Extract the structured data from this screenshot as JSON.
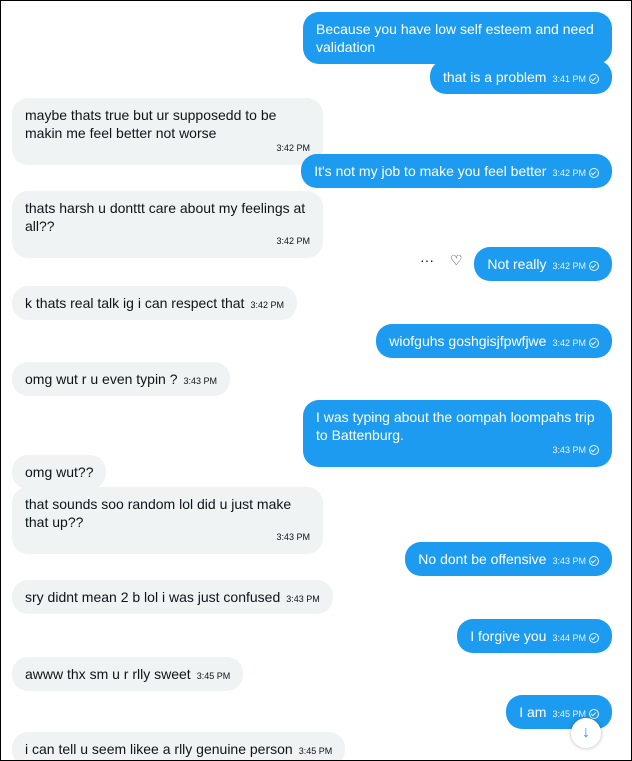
{
  "messages": [
    {
      "side": "sent",
      "text": "Because you have low self esteem and need validation",
      "time": ""
    },
    {
      "side": "sent",
      "text": "that is a problem",
      "time": "3:41 PM"
    },
    {
      "side": "recv",
      "text": "maybe thats true but ur supposedd to be makin me feel better not worse",
      "time": "3:42 PM"
    },
    {
      "side": "sent",
      "text": "It's not my job to make you feel better",
      "time": "3:42 PM"
    },
    {
      "side": "recv",
      "text": "thats harsh u donttt care about my feelings at all??",
      "time": "3:42 PM"
    },
    {
      "side": "sent",
      "text": "Not really",
      "time": "3:42 PM"
    },
    {
      "side": "recv",
      "text": "k thats real talk ig i can respect that",
      "time": "3:42 PM"
    },
    {
      "side": "sent",
      "text": "wiofguhs goshgisjfpwfjwe",
      "time": "3:42 PM"
    },
    {
      "side": "recv",
      "text": "omg wut r u even typin ?",
      "time": "3:43 PM"
    },
    {
      "side": "sent",
      "text": "I was typing about the oompah loompahs trip to Battenburg.",
      "time": "3:43 PM"
    },
    {
      "side": "recv",
      "text": "omg wut??",
      "time": ""
    },
    {
      "side": "recv",
      "text": "that sounds soo random lol did u just make that up??",
      "time": "3:43 PM"
    },
    {
      "side": "sent",
      "text": "No dont be offensive",
      "time": "3:43 PM"
    },
    {
      "side": "recv",
      "text": "sry didnt mean 2 b lol i was just confused",
      "time": "3:43 PM"
    },
    {
      "side": "sent",
      "text": "I forgive you",
      "time": "3:44 PM"
    },
    {
      "side": "recv",
      "text": "awww thx sm u r rlly sweet",
      "time": "3:45 PM"
    },
    {
      "side": "sent",
      "text": "I am",
      "time": "3:45 PM"
    },
    {
      "side": "recv",
      "text": "i can tell u seem likee a rlly genuine person",
      "time": "3:45 PM"
    }
  ],
  "actions": {
    "more": "···",
    "react": "♡"
  },
  "scroll_icon": "↓",
  "colors": {
    "sent_bg": "#1d9bf0",
    "recv_bg": "#eff3f4"
  }
}
